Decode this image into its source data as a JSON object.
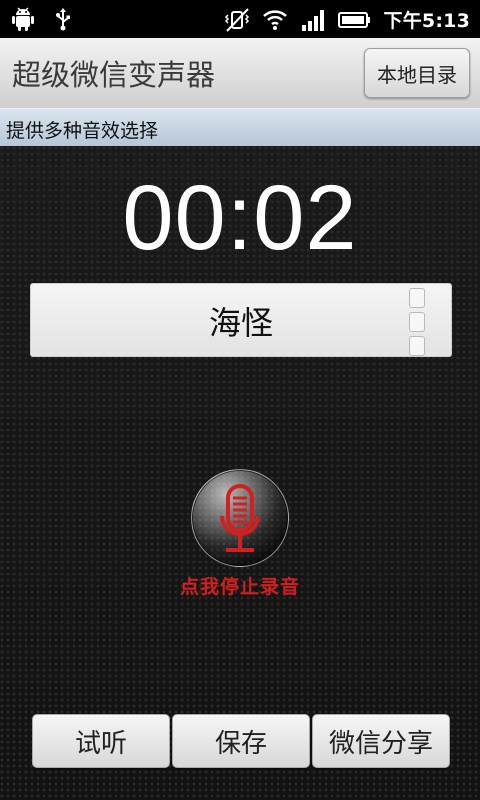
{
  "status_bar": {
    "time": "下午5:13",
    "left_icons": [
      "android-icon",
      "usb-icon"
    ],
    "right_icons": [
      "vibrate-off-icon",
      "wifi-icon",
      "signal-icon",
      "battery-icon"
    ]
  },
  "title_bar": {
    "title": "超级微信变声器",
    "local_dir_button": "本地目录"
  },
  "info_bar": {
    "text": "提供多种音效选择"
  },
  "recorder": {
    "timer": "00:02",
    "selected_voice": "海怪",
    "stop_hint": "点我停止录音",
    "accent_color": "#d21f1f"
  },
  "bottom_buttons": {
    "listen": "试听",
    "save": "保存",
    "share": "微信分享"
  }
}
